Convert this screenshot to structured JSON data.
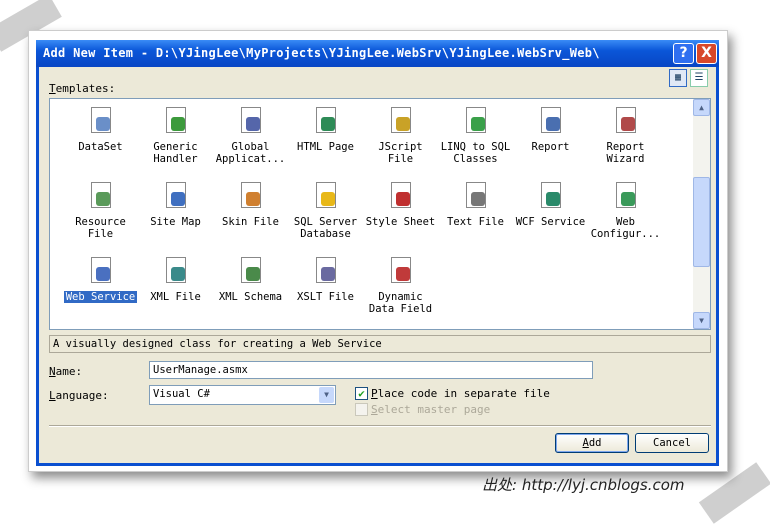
{
  "dialog": {
    "title": "Add New Item - D:\\YJingLee\\MyProjects\\YJingLee.WebSrv\\YJingLee.WebSrv_Web\\",
    "help": "?",
    "close": "X"
  },
  "templates_label_u": "T",
  "templates_label_rest": "emplates:",
  "templates": [
    {
      "label": "DataSet",
      "color": "#6a8fc8"
    },
    {
      "label": "Generic Handler",
      "color": "#3c9a3c"
    },
    {
      "label": "Global Applicat...",
      "color": "#5566aa"
    },
    {
      "label": "HTML Page",
      "color": "#2e8b57"
    },
    {
      "label": "JScript File",
      "color": "#c9a227"
    },
    {
      "label": "LINQ to SQL Classes",
      "color": "#3aa04a"
    },
    {
      "label": "Report",
      "color": "#4a6fb0"
    },
    {
      "label": "Report Wizard",
      "color": "#b04a4a"
    },
    {
      "label": "Resource File",
      "color": "#5a9a5a"
    },
    {
      "label": "Site Map",
      "color": "#3f6fc0"
    },
    {
      "label": "Skin File",
      "color": "#d08030"
    },
    {
      "label": "SQL Server Database",
      "color": "#e8b818"
    },
    {
      "label": "Style Sheet",
      "color": "#c03030"
    },
    {
      "label": "Text File",
      "color": "#777777"
    },
    {
      "label": "WCF Service",
      "color": "#2a8a6a"
    },
    {
      "label": "Web Configur...",
      "color": "#3a9a5a"
    },
    {
      "label": "Web Service",
      "color": "#4a70c0",
      "selected": true
    },
    {
      "label": "XML File",
      "color": "#3a8a8a"
    },
    {
      "label": "XML Schema",
      "color": "#4a8a4a"
    },
    {
      "label": "XSLT File",
      "color": "#6a6aa0"
    },
    {
      "label": "Dynamic Data Field",
      "color": "#c03a3a"
    }
  ],
  "description": "A visually designed class for creating a Web Service",
  "name": {
    "u": "N",
    "rest": "ame:",
    "value": "UserManage.asmx"
  },
  "language": {
    "u": "L",
    "rest": "anguage:",
    "value": "Visual C#"
  },
  "place_code": {
    "u": "P",
    "rest": "lace code in separate file",
    "checked": true
  },
  "master_page": {
    "u": "S",
    "rest": "elect master page",
    "checked": false,
    "disabled": true
  },
  "buttons": {
    "add_u": "A",
    "add_rest": "dd",
    "cancel": "Cancel"
  },
  "watermark": "出处: http://lyj.cnblogs.com"
}
